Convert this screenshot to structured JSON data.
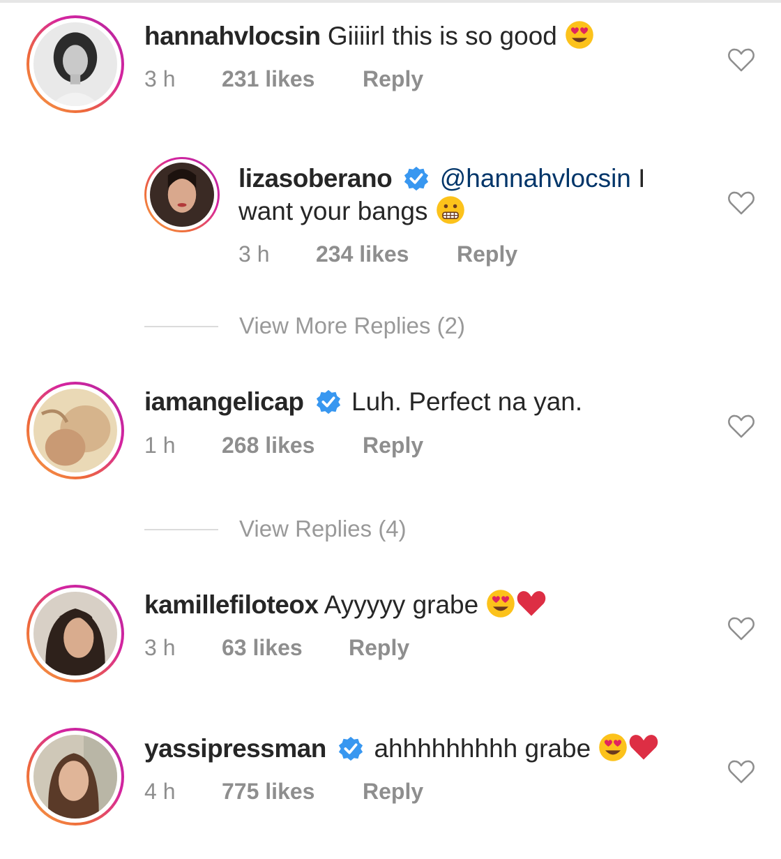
{
  "comments": [
    {
      "username": "hannahvlocsin",
      "verified": false,
      "text": "Giiiirl this is so good",
      "emoji": [
        "smiling-face-with-heart-eyes"
      ],
      "time": "3 h",
      "likes": "231 likes",
      "reply": "Reply"
    },
    {
      "username": "lizasoberano",
      "verified": true,
      "mention": "@hannahvlocsin",
      "text_line1_tail": "I",
      "text_line2": "want your bangs",
      "emoji": [
        "grimacing-face"
      ],
      "time": "3 h",
      "likes": "234 likes",
      "reply": "Reply"
    },
    {
      "username": "iamangelicap",
      "verified": true,
      "text": "Luh. Perfect na yan.",
      "time": "1 h",
      "likes": "268 likes",
      "reply": "Reply"
    },
    {
      "username": "kamillefiloteox",
      "verified": false,
      "text": "Ayyyyy grabe",
      "emoji": [
        "smiling-face-with-heart-eyes",
        "red-heart"
      ],
      "time": "3 h",
      "likes": "63 likes",
      "reply": "Reply"
    },
    {
      "username": "yassipressman",
      "verified": true,
      "text": "ahhhhhhhhh grabe",
      "emoji": [
        "smiling-face-with-heart-eyes",
        "red-heart"
      ],
      "time": "4 h",
      "likes": "775 likes",
      "reply": "Reply"
    }
  ],
  "view_more_replies": "View More Replies (2)",
  "view_replies": "View Replies (4)",
  "colors": {
    "text": "#262626",
    "meta": "#8e8e8e",
    "mention": "#003569",
    "verified": "#3897f0",
    "ring_start": "#f7a34b",
    "ring_end": "#b0289f"
  }
}
